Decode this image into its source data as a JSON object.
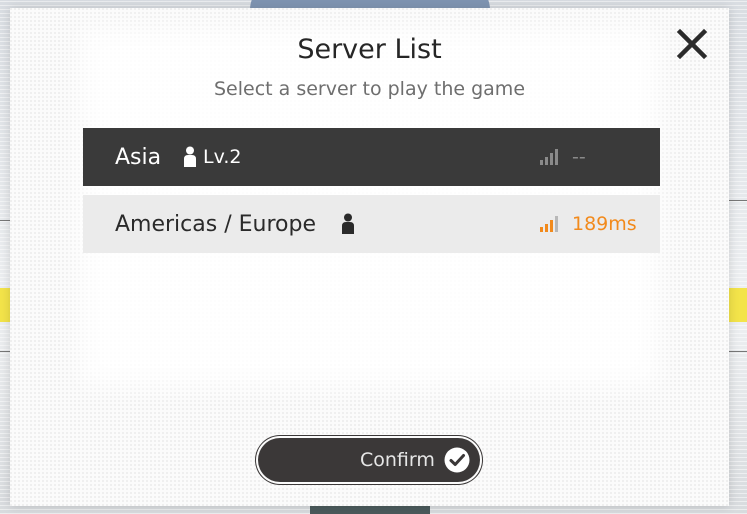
{
  "dialog": {
    "title": "Server List",
    "subtitle": "Select a server to play the game",
    "close_icon": "close-icon"
  },
  "servers": [
    {
      "name": "Asia",
      "level": "Lv.2",
      "ping": "--",
      "selected": true,
      "signal_color": "#8a8a8a"
    },
    {
      "name": "Americas / Europe",
      "level": "",
      "ping": "189ms",
      "selected": false,
      "signal_color": "#f28a1c"
    }
  ],
  "confirm": {
    "label": "Confirm",
    "icon": "check-circle-icon"
  },
  "colors": {
    "selected_row": "#3a3a3a",
    "normal_row": "#ebebeb",
    "ping_good": "#f28a1c",
    "ping_unknown": "#8a8a8a",
    "button": "#3b3838"
  }
}
